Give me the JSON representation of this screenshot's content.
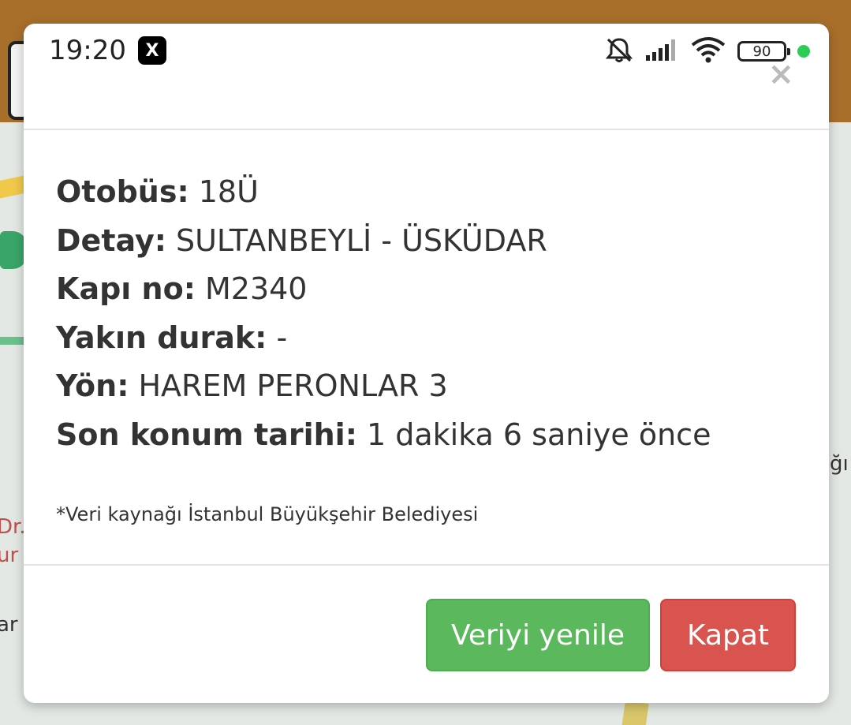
{
  "status_bar": {
    "time": "19:20",
    "app_icon": "X",
    "battery_level": "90"
  },
  "modal": {
    "close_glyph": "×",
    "fields": [
      {
        "key": "Otobüs:",
        "value": " 18Ü"
      },
      {
        "key": "Detay:",
        "value": " SULTANBEYLİ - ÜSKÜDAR"
      },
      {
        "key": "Kapı no:",
        "value": " M2340"
      },
      {
        "key": "Yakın durak:",
        "value": " -"
      },
      {
        "key": "Yön:",
        "value": " HAREM PERONLAR 3"
      },
      {
        "key": "Son konum tarihi:",
        "value": " 1 dakika 6 saniye önce"
      }
    ],
    "source_note": "*Veri kaynağı İstanbul Büyükşehir Belediyesi",
    "refresh_button": "Veriyi yenile",
    "close_button": "Kapat"
  },
  "background": {
    "map_text_1": "Dr.",
    "map_text_2": "ur",
    "map_text_3": "ar",
    "map_text_4": "ğı"
  },
  "colors": {
    "refresh": "#5cb85c",
    "close": "#d9534f",
    "status_dot": "#2ecc55"
  }
}
